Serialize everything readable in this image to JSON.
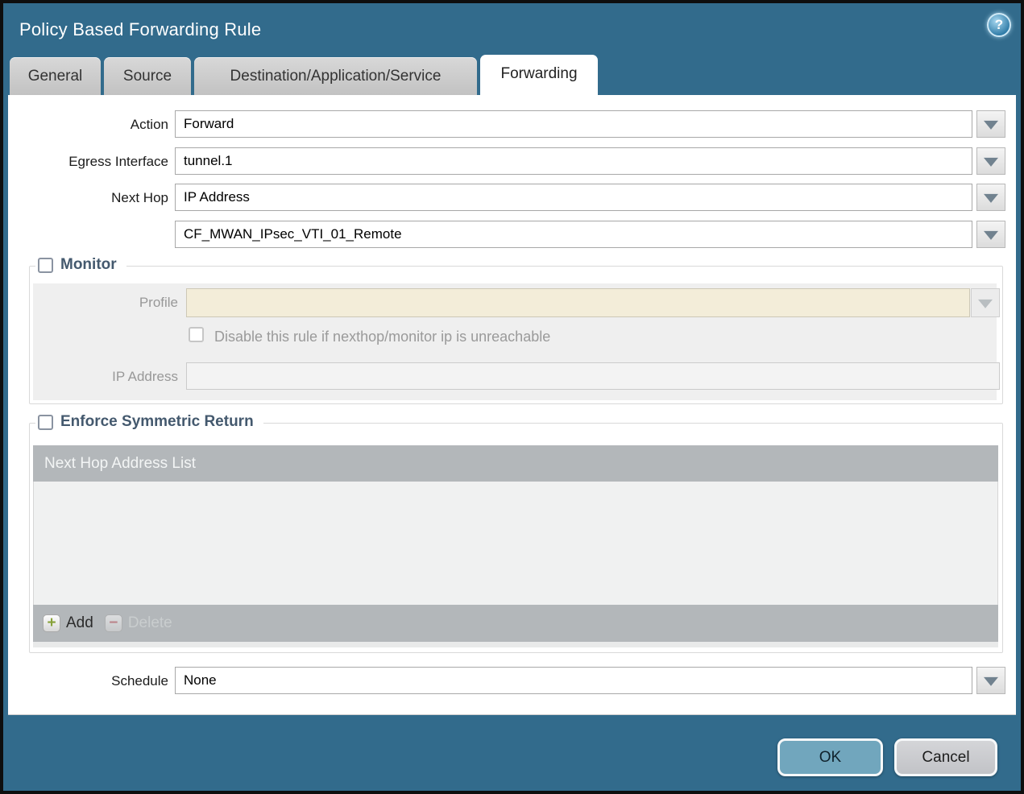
{
  "window": {
    "title": "Policy Based Forwarding Rule",
    "help_glyph": "?"
  },
  "tabs": [
    {
      "label": "General",
      "active": false
    },
    {
      "label": "Source",
      "active": false
    },
    {
      "label": "Destination/Application/Service",
      "active": false
    },
    {
      "label": "Forwarding",
      "active": true
    }
  ],
  "form": {
    "action": {
      "label": "Action",
      "value": "Forward"
    },
    "egress_interface": {
      "label": "Egress Interface",
      "value": "tunnel.1"
    },
    "next_hop": {
      "label": "Next Hop",
      "value": "IP Address"
    },
    "next_hop_address": {
      "value": "CF_MWAN_IPsec_VTI_01_Remote"
    },
    "schedule": {
      "label": "Schedule",
      "value": "None"
    }
  },
  "monitor": {
    "legend": "Monitor",
    "checked": false,
    "profile": {
      "label": "Profile",
      "value": ""
    },
    "disable_rule": {
      "label": "Disable this rule if nexthop/monitor ip is unreachable",
      "checked": false
    },
    "ip_address": {
      "label": "IP Address",
      "value": ""
    }
  },
  "enforce_symmetric_return": {
    "legend": "Enforce Symmetric Return",
    "checked": false,
    "table": {
      "header": "Next Hop Address List",
      "rows": []
    },
    "add_label": "Add",
    "delete_label": "Delete",
    "add_glyph": "+",
    "delete_glyph": "−"
  },
  "footer": {
    "ok_label": "OK",
    "cancel_label": "Cancel"
  },
  "colors": {
    "chrome": "#326b8c",
    "table_header": "#b3b7ba",
    "ok_button": "#71a6bd",
    "profile_disabled_bg": "#f3edd9",
    "legend_text": "#44596e"
  }
}
